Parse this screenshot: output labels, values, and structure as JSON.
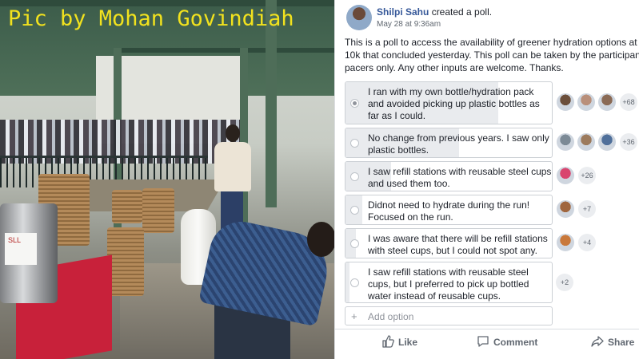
{
  "photo": {
    "watermark": "Pic by Mohan Govindiah",
    "drum_label": "SLL"
  },
  "post": {
    "author": "Shilpi Sahu",
    "action_text": "created a poll.",
    "timestamp": "May 28 at 9:36am",
    "description_lines": [
      "This is a poll to access the availability of greener hydration options at T",
      "10k that concluded yesterday. This poll can be taken by the participants",
      "pacers only. Any other inputs are welcome. Thanks."
    ],
    "poll": {
      "options": [
        {
          "lines": [
            "I ran with my own bottle/hydration pack",
            "and avoided picking up plastic bottles as",
            "far as I could."
          ],
          "more_voters": "+68",
          "selected": true,
          "fill_fraction": 0.74,
          "avatar_colors": [
            "#6b4e3a",
            "#b98f7a",
            "#8a6a55"
          ]
        },
        {
          "lines": [
            "No change from previous years. I saw only",
            "plastic bottles."
          ],
          "more_voters": "+36",
          "selected": false,
          "fill_fraction": 0.55,
          "avatar_colors": [
            "#7c8a96",
            "#9c7a5c",
            "#4f6f9a"
          ]
        },
        {
          "lines": [
            "I saw refill stations with reusable steel cups",
            "and used them too."
          ],
          "more_voters": "+26",
          "selected": false,
          "fill_fraction": 0.22,
          "avatar_colors": [
            "#d9456f"
          ]
        },
        {
          "lines": [
            "Didnot need to hydrate during the run!",
            "Focused on the run."
          ],
          "more_voters": "+7",
          "selected": false,
          "fill_fraction": 0.08,
          "avatar_colors": [
            "#a0663e"
          ]
        },
        {
          "lines": [
            "I was aware that there will be refill stations",
            "with steel cups, but I could not spot any."
          ],
          "more_voters": "+4",
          "selected": false,
          "fill_fraction": 0.05,
          "avatar_colors": [
            "#c9783a"
          ]
        },
        {
          "lines": [
            "I saw refill stations with reusable steel",
            "cups, but I preferred to pick up bottled",
            "water instead of reusable cups."
          ],
          "more_voters": "+2",
          "selected": false,
          "fill_fraction": 0.02,
          "avatar_colors": []
        }
      ],
      "add_option_label": "Add option"
    },
    "actions": {
      "like": "Like",
      "comment": "Comment",
      "share": "Share"
    }
  }
}
